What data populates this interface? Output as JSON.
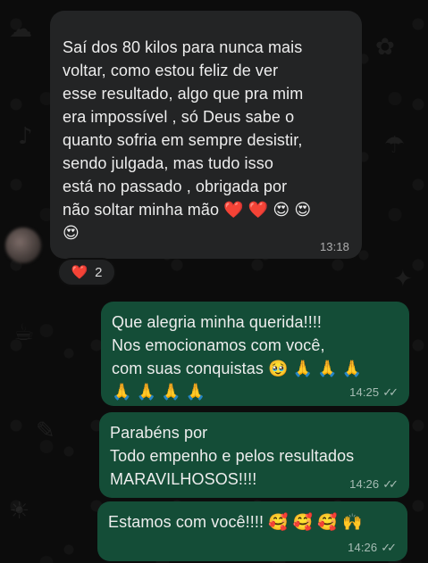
{
  "incoming_message": {
    "text": "Saí dos 80 kilos para nunca mais\nvoltar, como estou feliz de ver\nesse resultado, algo que pra mim\nera impossível , só Deus sabe o\nquanto sofria em sempre desistir,\nsendo julgada, mas tudo isso\nestá no passado , obrigada por\nnão soltar minha mão ❤️ ❤️ 😍 😍\n😍",
    "time": "13:18",
    "reaction": {
      "emoji": "❤️",
      "count": "2"
    }
  },
  "outgoing_messages": [
    {
      "text": "Que alegria minha querida!!!!\nNos emocionamos com você,\ncom suas conquistas 🥹 🙏 🙏 🙏\n🙏 🙏 🙏 🙏",
      "time": "14:25"
    },
    {
      "text": "Parabéns por\nTodo empenho e pelos resultados\nMARAVILHOSOS!!!!",
      "time": "14:26"
    },
    {
      "text": "Estamos com você!!!! 🥰 🥰 🥰 🙌",
      "time": "14:26"
    }
  ],
  "icons": {
    "read_receipt": "double-check-icon",
    "reaction_heart": "heart-icon"
  },
  "colors": {
    "incoming_bubble": "#232425",
    "outgoing_bubble": "#144d37",
    "background": "#0c0c0c"
  }
}
